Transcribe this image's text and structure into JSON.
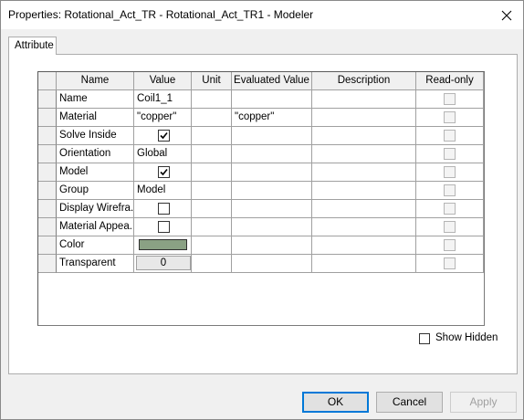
{
  "window": {
    "title": "Properties: Rotational_Act_TR - Rotational_Act_TR1 - Modeler"
  },
  "tabs": [
    {
      "label": "Attribute"
    }
  ],
  "table": {
    "columns": [
      "Name",
      "Value",
      "Unit",
      "Evaluated Value",
      "Description",
      "Read-only"
    ],
    "rows": [
      {
        "name": "Name",
        "value": "Coil1_1",
        "type": "text",
        "evaluated": "",
        "readonly_checked": false
      },
      {
        "name": "Material",
        "value": "\"copper\"",
        "type": "text",
        "evaluated": "\"copper\"",
        "readonly_checked": false
      },
      {
        "name": "Solve Inside",
        "value": "",
        "type": "checkbox",
        "checked": true,
        "evaluated": "",
        "readonly_checked": false
      },
      {
        "name": "Orientation",
        "value": "Global",
        "type": "text",
        "evaluated": "",
        "readonly_checked": false
      },
      {
        "name": "Model",
        "value": "",
        "type": "checkbox",
        "checked": true,
        "evaluated": "",
        "readonly_checked": false
      },
      {
        "name": "Group",
        "value": "Model",
        "type": "text",
        "evaluated": "",
        "readonly_checked": false
      },
      {
        "name": "Display Wirefra...",
        "value": "",
        "type": "checkbox",
        "checked": false,
        "evaluated": "",
        "readonly_checked": false
      },
      {
        "name": "Material Appea...",
        "value": "",
        "type": "checkbox",
        "checked": false,
        "evaluated": "",
        "readonly_checked": false
      },
      {
        "name": "Color",
        "value": "",
        "type": "color",
        "color": "#8aa184",
        "evaluated": "",
        "readonly_checked": false
      },
      {
        "name": "Transparent",
        "value": "0",
        "type": "spin",
        "evaluated": "",
        "readonly_checked": false
      }
    ]
  },
  "show_hidden": {
    "label": "Show Hidden",
    "checked": false
  },
  "buttons": {
    "ok": "OK",
    "cancel": "Cancel",
    "apply": "Apply"
  },
  "colors": {
    "accent": "#0078d7",
    "window_bg": "#f0f0f0"
  }
}
